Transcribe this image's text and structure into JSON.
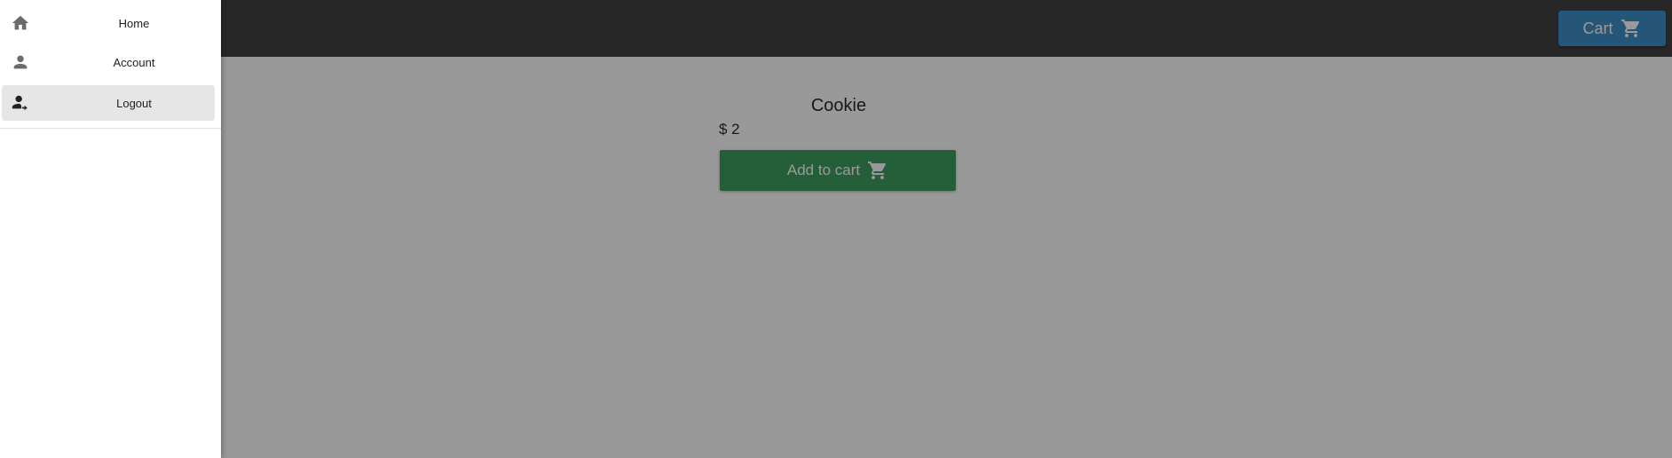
{
  "drawer": {
    "items": [
      {
        "label": "Home",
        "icon": "home-icon"
      },
      {
        "label": "Account",
        "icon": "account-icon"
      },
      {
        "label": "Logout",
        "icon": "logout-icon",
        "active": true
      }
    ]
  },
  "header": {
    "cart_label": "Cart",
    "cart_icon": "cart-icon"
  },
  "product": {
    "name": "Cookie",
    "price": "$ 2",
    "add_to_cart_label": "Add to cart",
    "add_to_cart_icon": "cart-icon"
  },
  "colors": {
    "app_bar": "#424242",
    "cart_button": "#3e8fc8",
    "add_to_cart_button": "#3e9f5f",
    "scrim": "rgba(0,0,0,0.4)",
    "drawer_active": "#e6e6e6"
  }
}
